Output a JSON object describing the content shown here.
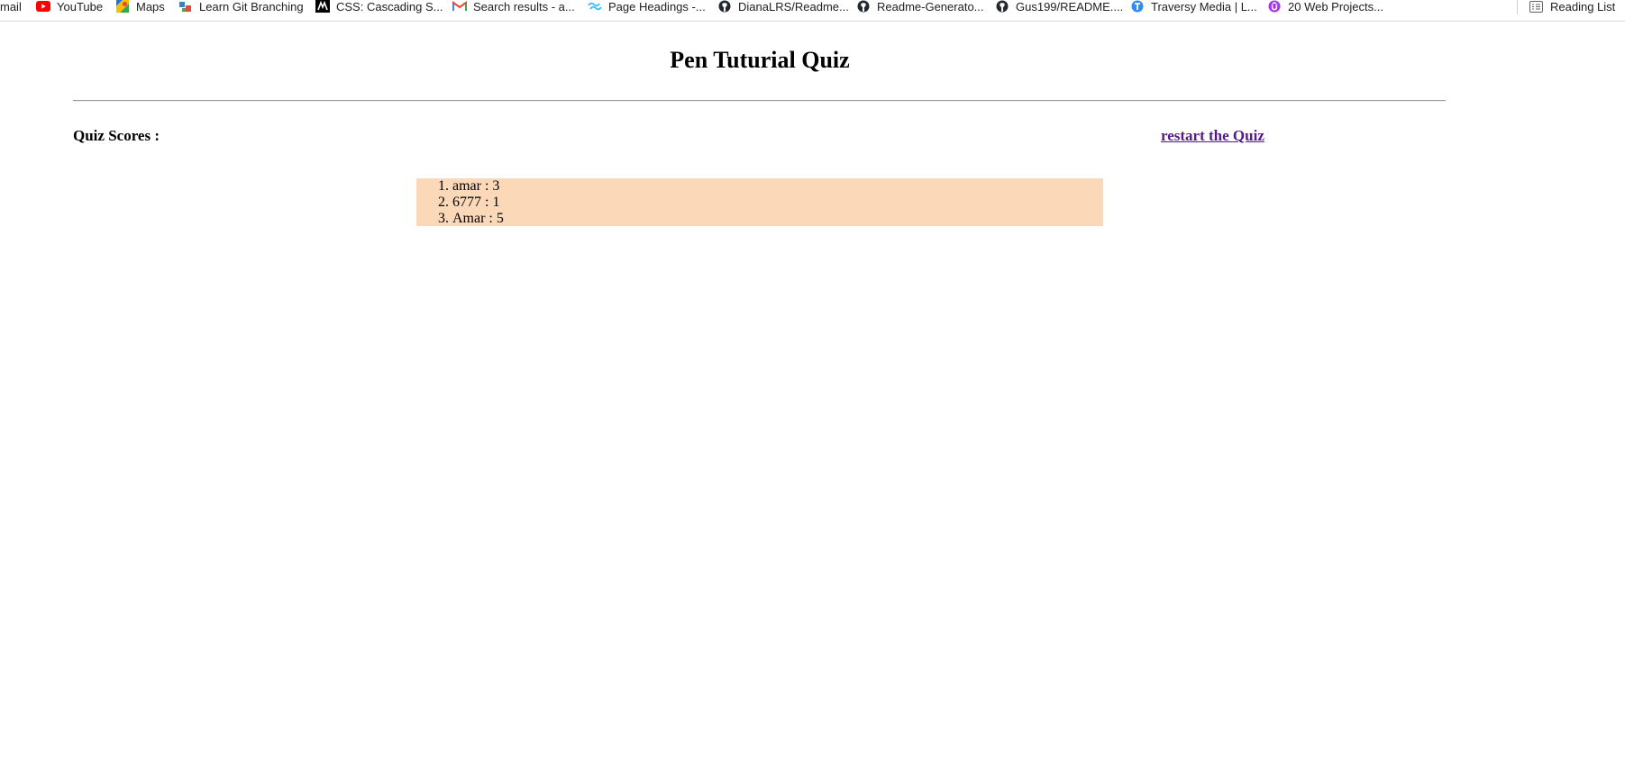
{
  "bookmarks": [
    {
      "label": "mail",
      "icon": "gmail-icon"
    },
    {
      "label": "YouTube",
      "icon": "youtube-icon"
    },
    {
      "label": "Maps",
      "icon": "maps-icon"
    },
    {
      "label": "Learn Git Branching",
      "icon": "git-branching-icon"
    },
    {
      "label": "CSS: Cascading S...",
      "icon": "mdn-icon"
    },
    {
      "label": "Search results - a...",
      "icon": "gmail-icon"
    },
    {
      "label": "Page Headings -...",
      "icon": "tailwind-icon"
    },
    {
      "label": "DianaLRS/Readme...",
      "icon": "github-icon"
    },
    {
      "label": "Readme-Generato...",
      "icon": "github-icon"
    },
    {
      "label": "Gus199/README....",
      "icon": "github-icon"
    },
    {
      "label": "Traversy Media | L...",
      "icon": "traversy-icon"
    },
    {
      "label": "20 Web Projects...",
      "icon": "udemy-icon"
    }
  ],
  "reading_list": {
    "label": "Reading List",
    "icon": "reading-list-icon"
  },
  "page": {
    "title": "Pen Tuturial Quiz",
    "scores_heading": "Quiz Scores :",
    "restart_label": "restart the Quiz",
    "scores": [
      "amar : 3",
      "6777 : 1",
      "Amar : 5"
    ]
  },
  "colors": {
    "scores_background": "#fbd8b7",
    "visited_link": "#551a8b",
    "youtube_red": "#ff0000",
    "github_black": "#24292f",
    "traversy_blue": "#2f8cf0",
    "udemy_purple": "#a435f0"
  }
}
